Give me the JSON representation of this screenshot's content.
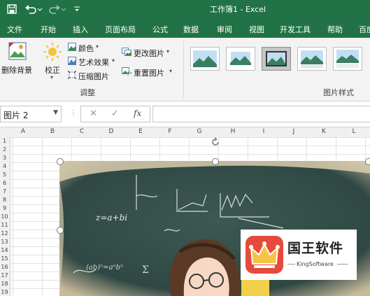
{
  "app": {
    "title": "工作簿1 - Excel",
    "accent": "#217346"
  },
  "quick_access": {
    "save_icon": "save-icon",
    "undo_icon": "undo-icon",
    "redo_icon": "redo-icon",
    "customize_icon": "customize-icon"
  },
  "tabs": [
    "文件",
    "开始",
    "插入",
    "页面布局",
    "公式",
    "数据",
    "审阅",
    "视图",
    "开发工具",
    "帮助",
    "百度"
  ],
  "ribbon": {
    "remove_bg": "删除背景",
    "correct": "校正",
    "color": "颜色",
    "artistic": "艺术效果",
    "compress": "压缩图片",
    "change_pic": "更改图片",
    "reset_pic": "重置图片",
    "group_adjust": "调整",
    "group_styles": "图片样式"
  },
  "formula": {
    "name_box": "图片 2",
    "cancel": "✕",
    "enter": "✓",
    "fx": "fx",
    "value": ""
  },
  "columns": [
    "A",
    "B",
    "C",
    "D",
    "E",
    "F",
    "G",
    "H",
    "I",
    "J",
    "K",
    "L"
  ],
  "rows": [
    "1",
    "2",
    "3",
    "4",
    "5",
    "6",
    "7",
    "8",
    "9",
    "10",
    "11",
    "12",
    "13",
    "14",
    "15",
    "16",
    "17",
    "18",
    "19"
  ],
  "picture": {
    "formula_text": "z=a+bi",
    "name": "图片 2"
  },
  "watermark": {
    "title": "国王软件",
    "subtitle": "KingSoftware",
    "logo_color": "#e64a3a"
  }
}
